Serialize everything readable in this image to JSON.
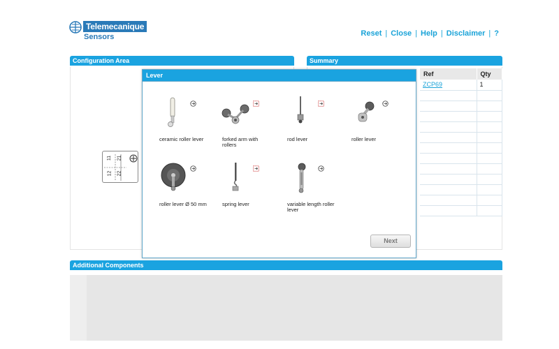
{
  "brand": {
    "name": "Telemecanique",
    "sub": "Sensors"
  },
  "topnav": {
    "items": [
      "Reset",
      "Close",
      "Help",
      "Disclaimer",
      "?"
    ],
    "separator": "|"
  },
  "sections": {
    "configuration_title": "Configuration Area",
    "summary_title": "Summary",
    "additional_title": "Additional Components"
  },
  "diagram": {
    "labels": [
      "11",
      "21",
      "12",
      "22"
    ]
  },
  "summary_table": {
    "headers": [
      "Ref",
      "Qty"
    ],
    "rows": [
      {
        "ref": "ZCP69",
        "qty": "1"
      },
      {
        "ref": "",
        "qty": ""
      },
      {
        "ref": "",
        "qty": ""
      },
      {
        "ref": "",
        "qty": ""
      },
      {
        "ref": "",
        "qty": ""
      },
      {
        "ref": "",
        "qty": ""
      },
      {
        "ref": "",
        "qty": ""
      },
      {
        "ref": "",
        "qty": ""
      },
      {
        "ref": "",
        "qty": ""
      },
      {
        "ref": "",
        "qty": ""
      },
      {
        "ref": "",
        "qty": ""
      },
      {
        "ref": "",
        "qty": ""
      },
      {
        "ref": "",
        "qty": ""
      }
    ]
  },
  "lever_modal": {
    "title": "Lever",
    "items": [
      {
        "label": "ceramic roller lever",
        "icon": "circle-arrow-icon"
      },
      {
        "label": "forked arm with rollers",
        "icon": "red-arrow-icon"
      },
      {
        "label": "rod lever",
        "icon": "red-arrow-icon"
      },
      {
        "label": "roller lever",
        "icon": "circle-arrow-icon"
      },
      {
        "label": "roller lever Ø 50 mm",
        "icon": "circle-arrow-icon"
      },
      {
        "label": "spring lever",
        "icon": "red-arrow-icon"
      },
      {
        "label": "variable length roller lever",
        "icon": "circle-arrow-icon"
      }
    ],
    "next_label": "Next"
  },
  "colors": {
    "accent": "#1aa3e0",
    "brand": "#2a7ab8",
    "link": "#1aa3d8"
  }
}
